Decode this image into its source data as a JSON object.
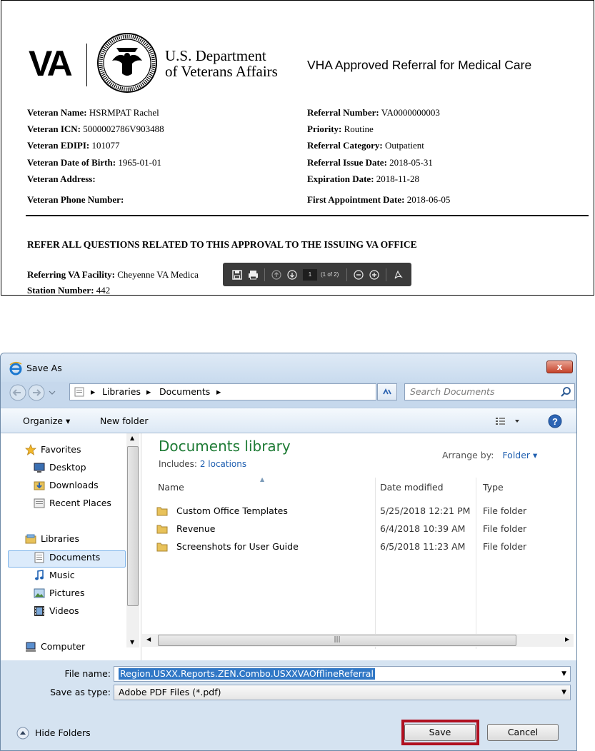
{
  "pdf": {
    "va_logo": "VA",
    "dept_line1": "U.S. Department",
    "dept_line2": "of Veterans Affairs",
    "doc_title": "VHA Approved Referral for Medical Care",
    "left": [
      {
        "label": "Veteran Name:",
        "value": "HSRMPAT  Rachel"
      },
      {
        "label": "Veteran ICN:",
        "value": "5000002786V903488"
      },
      {
        "label": "Veteran EDIPI:",
        "value": "101077"
      },
      {
        "label": "Veteran Date of Birth:",
        "value": "1965-01-01"
      },
      {
        "label": "Veteran Address:",
        "value": ""
      },
      {
        "label": "Veteran Phone Number:",
        "value": ""
      }
    ],
    "right": [
      {
        "label": "Referral Number:",
        "value": "VA0000000003"
      },
      {
        "label": "Priority:",
        "value": "Routine"
      },
      {
        "label": "Referral Category:",
        "value": "Outpatient"
      },
      {
        "label": "Referral Issue Date:",
        "value": "2018-05-31"
      },
      {
        "label": "Expiration Date:",
        "value": "2018-11-28"
      },
      {
        "label": "First Appointment Date:",
        "value": "2018-06-05"
      }
    ],
    "notice": "REFER ALL QUESTIONS RELATED TO THIS APPROVAL TO THE ISSUING VA OFFICE",
    "facility_label": "Referring VA Facility:",
    "facility_value": "Cheyenne VA Medica",
    "station_label": "Station Number:",
    "station_value": "442",
    "toolbar": {
      "page": "1",
      "page_count": "(1 of 2)"
    }
  },
  "dialog": {
    "title": "Save As",
    "close_label": "x",
    "breadcrumb": [
      "Libraries",
      "Documents"
    ],
    "search_placeholder": "Search Documents",
    "organize": "Organize ▾",
    "new_folder": "New folder",
    "nav": {
      "favorites": "Favorites",
      "desktop": "Desktop",
      "downloads": "Downloads",
      "recent_places": "Recent Places",
      "libraries": "Libraries",
      "documents": "Documents",
      "music": "Music",
      "pictures": "Pictures",
      "videos": "Videos",
      "computer": "Computer"
    },
    "library_title": "Documents library",
    "includes_label": "Includes:",
    "includes_link": "2 locations",
    "arrange_by_label": "Arrange by:",
    "arrange_by_value": "Folder ▾",
    "columns": {
      "name": "Name",
      "date": "Date modified",
      "type": "Type"
    },
    "files": [
      {
        "name": "Custom Office Templates",
        "date": "5/25/2018 12:21 PM",
        "type": "File folder"
      },
      {
        "name": "Revenue",
        "date": "6/4/2018 10:39 AM",
        "type": "File folder"
      },
      {
        "name": "Screenshots for User Guide",
        "date": "6/5/2018 11:23 AM",
        "type": "File folder"
      }
    ],
    "file_name_label": "File name:",
    "file_name_value": "Region.USXX.Reports.ZEN.Combo.USXXVAOfflineReferral",
    "save_type_label": "Save as type:",
    "save_type_value": "Adobe PDF Files (*.pdf)",
    "hide_folders": "Hide Folders",
    "save_button": "Save",
    "cancel_button": "Cancel",
    "colors": {
      "highlight": "#b01020",
      "library_title": "#1e7b35",
      "link": "#1f5fb0"
    }
  }
}
